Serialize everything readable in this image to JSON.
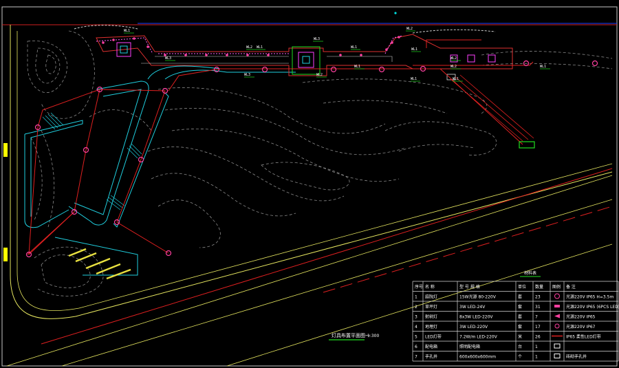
{
  "plan": {
    "title": "灯具布置平面图一",
    "scale": "1:300",
    "wl_tags": [
      "WL1",
      "WL2",
      "WL1",
      "WL3",
      "WL1",
      "WL2",
      "WL1",
      "WL2",
      "WL1",
      "WL2",
      "WL1",
      "WL3",
      "WL2",
      "WL1",
      "WL1",
      "WL3"
    ]
  },
  "legend": {
    "title": "材料表",
    "headers": [
      "序号",
      "名 称",
      "型 号 规 格",
      "单位",
      "数量",
      "图例",
      "备 注"
    ],
    "rows": [
      {
        "no": "1",
        "name": "庭院灯",
        "spec": "15W光源 80-220V",
        "unit": "套",
        "qty": "23",
        "note": "光源220V IP65 H=3.5m"
      },
      {
        "no": "2",
        "name": "草坪灯",
        "spec": "3W LED-24V",
        "unit": "套",
        "qty": "31",
        "note": "光源220V IP65 (6PCS LED)"
      },
      {
        "no": "3",
        "name": "射树灯",
        "spec": "8x3W LED-220V",
        "unit": "套",
        "qty": "7",
        "note": "光源220V IP65"
      },
      {
        "no": "4",
        "name": "地埋灯",
        "spec": "3W LED-220V",
        "unit": "套",
        "qty": "17",
        "note": "光源220V IP67"
      },
      {
        "no": "5",
        "name": "LED灯带",
        "spec": "7.2W/m LED-220V",
        "unit": "米",
        "qty": "26",
        "note": "IP65 柔性LED灯带"
      },
      {
        "no": "6",
        "name": "配电箱",
        "spec": "照明配电箱",
        "unit": "台",
        "qty": "1",
        "note": ""
      },
      {
        "no": "7",
        "name": "手孔井",
        "spec": "600x600x600mm",
        "unit": "个",
        "qty": "1",
        "note": "砖砌手孔井"
      }
    ]
  }
}
